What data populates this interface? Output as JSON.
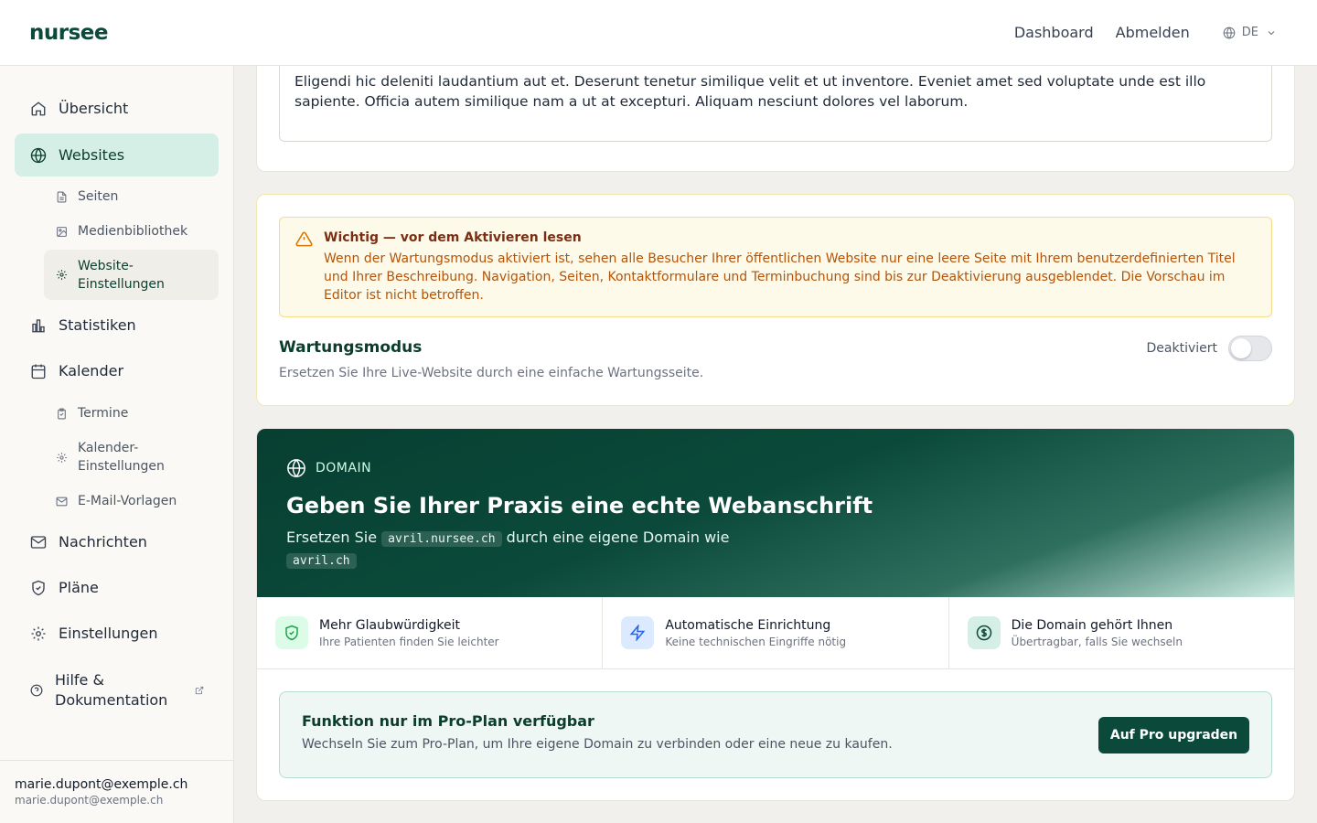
{
  "header": {
    "logo": "nursee",
    "links": [
      "Dashboard",
      "Abmelden"
    ],
    "lang": "DE"
  },
  "sidebar": {
    "items": [
      {
        "label": "Übersicht",
        "icon": "home-icon"
      },
      {
        "label": "Websites",
        "icon": "globe-icon",
        "active": true
      },
      {
        "label": "Statistiken",
        "icon": "bar-chart-icon"
      },
      {
        "label": "Kalender",
        "icon": "calendar-icon"
      },
      {
        "label": "Nachrichten",
        "icon": "mail-icon"
      },
      {
        "label": "Pläne",
        "icon": "shield-icon"
      },
      {
        "label": "Einstellungen",
        "icon": "gear-icon"
      },
      {
        "label": "Hilfe & Dokumentation",
        "icon": "help-icon"
      }
    ],
    "website_sub": [
      {
        "label": "Seiten",
        "icon": "file-icon"
      },
      {
        "label": "Medienbibliothek",
        "icon": "image-icon"
      },
      {
        "label": "Website-Einstellungen",
        "icon": "gear-icon",
        "active": true
      }
    ],
    "calendar_sub": [
      {
        "label": "Termine",
        "icon": "clipboard-icon"
      },
      {
        "label": "Kalender-Einstellungen",
        "icon": "gear-icon"
      },
      {
        "label": "E-Mail-Vorlagen",
        "icon": "mail-icon"
      }
    ],
    "user": {
      "name": "marie.dupont@exemple.ch",
      "email": "marie.dupont@exemple.ch"
    }
  },
  "description_card": {
    "text": "Eligendi hic deleniti laudantium aut et. Deserunt tenetur similique velit et ut inventore. Eveniet amet sed voluptate unde est illo sapiente. Officia autem similique nam a ut at excepturi. Aliquam nesciunt dolores vel laborum."
  },
  "maintenance": {
    "warning_title": "Wichtig — vor dem Aktivieren lesen",
    "warning_text": "Wenn der Wartungsmodus aktiviert ist, sehen alle Besucher Ihrer öffentlichen Website nur eine leere Seite mit Ihrem benutzerdefinierten Titel und Ihrer Beschreibung. Navigation, Seiten, Kontaktformulare und Terminbuchung sind bis zur Deaktivierung ausgeblendet. Die Vorschau im Editor ist nicht betroffen.",
    "title": "Wartungsmodus",
    "subtitle": "Ersetzen Sie Ihre Live-Website durch eine einfache Wartungsseite.",
    "toggle_label": "Deaktiviert",
    "enabled": false
  },
  "domain": {
    "kicker": "DOMAIN",
    "title": "Geben Sie Ihrer Praxis eine echte Webanschrift",
    "desc_prefix": "Ersetzen Sie",
    "current_domain": "avril.nursee.ch",
    "desc_middle": "durch eine eigene Domain wie",
    "example_domain": "avril.ch",
    "features": [
      {
        "title": "Mehr Glaubwürdigkeit",
        "sub": "Ihre Patienten finden Sie leichter",
        "icon": "shield-check-icon",
        "color": "#16a34a",
        "bg": "#dcfce7"
      },
      {
        "title": "Automatische Einrichtung",
        "sub": "Keine technischen Eingriffe nötig",
        "icon": "lightning-icon",
        "color": "#2563eb",
        "bg": "#dbeafe"
      },
      {
        "title": "Die Domain gehört Ihnen",
        "sub": "Übertragbar, falls Sie wechseln",
        "icon": "dollar-icon",
        "color": "#0b4a3a",
        "bg": "#d6efe6"
      }
    ],
    "pro_title": "Funktion nur im Pro-Plan verfügbar",
    "pro_sub": "Wechseln Sie zum Pro-Plan, um Ihre eigene Domain zu verbinden oder eine neue zu kaufen.",
    "pro_button": "Auf Pro upgraden"
  }
}
